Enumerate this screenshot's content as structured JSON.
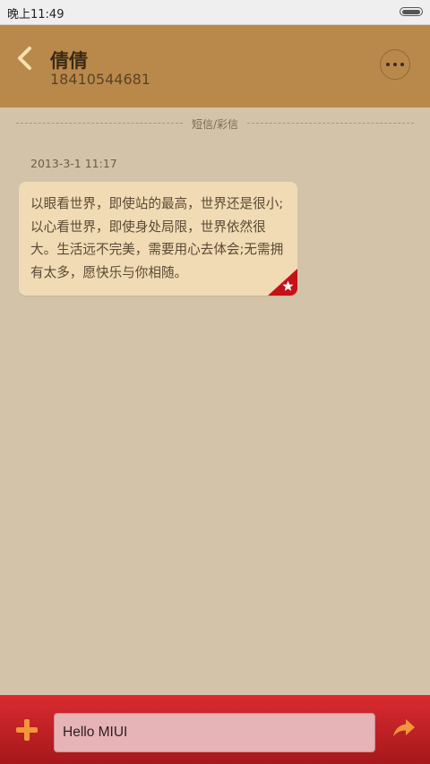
{
  "status_bar": {
    "time": "晚上11:49",
    "battery_icon": "battery-icon"
  },
  "header": {
    "back_icon": "chevron-left-icon",
    "contact_name": "倩倩",
    "contact_number": "18410544681",
    "more_icon": "more-icon"
  },
  "conversation": {
    "divider_label": "短信/彩信",
    "messages": [
      {
        "timestamp": "2013-3-1 11:17",
        "text": "以眼看世界，即使站的最高，世界还是很小;以心看世界，即使身处局限，世界依然很大。生活远不完美，需要用心去体会;无需拥有太多，愿快乐与你相随。",
        "badge_icon": "star-icon"
      }
    ]
  },
  "compose": {
    "add_icon": "plus-icon",
    "input_value": "Hello MIUI",
    "send_icon": "send-icon"
  },
  "colors": {
    "accent_orange": "#f4953d",
    "header_bg": "#b9894c",
    "bottom_bar": "#c72327",
    "bubble_bg": "#f1dbb4"
  }
}
